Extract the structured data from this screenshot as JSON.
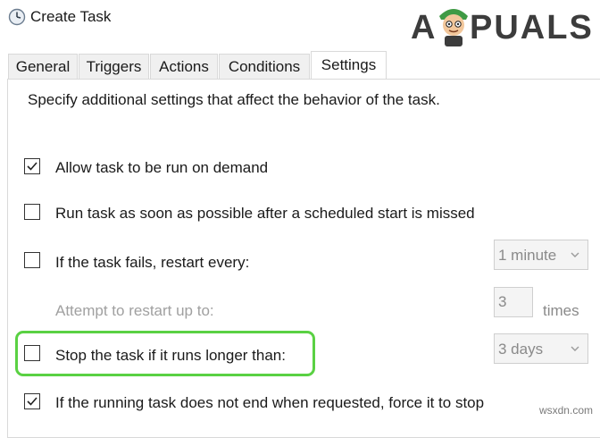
{
  "window": {
    "title": "Create Task"
  },
  "watermark": {
    "a": "A",
    "rest": "PUALS"
  },
  "tabs": [
    {
      "label": "General"
    },
    {
      "label": "Triggers"
    },
    {
      "label": "Actions"
    },
    {
      "label": "Conditions"
    },
    {
      "label": "Settings",
      "active": true
    }
  ],
  "settings": {
    "description": "Specify additional settings that affect the behavior of the task.",
    "allow_on_demand": {
      "label": "Allow task to be run on demand",
      "checked": true
    },
    "run_asap": {
      "label": "Run task as soon as possible after a scheduled start is missed",
      "checked": false
    },
    "restart_on_fail": {
      "label": "If the task fails, restart every:",
      "checked": false,
      "value": "1 minute"
    },
    "restart_attempts": {
      "label": "Attempt to restart up to:",
      "value": "3",
      "unit": "times"
    },
    "stop_if_longer": {
      "label": "Stop the task if it runs longer than:",
      "checked": false,
      "value": "3 days"
    },
    "force_stop": {
      "label": "If the running task does not end when requested, force it to stop",
      "checked": true
    }
  },
  "footer": {
    "site": "wsxdn.com"
  }
}
